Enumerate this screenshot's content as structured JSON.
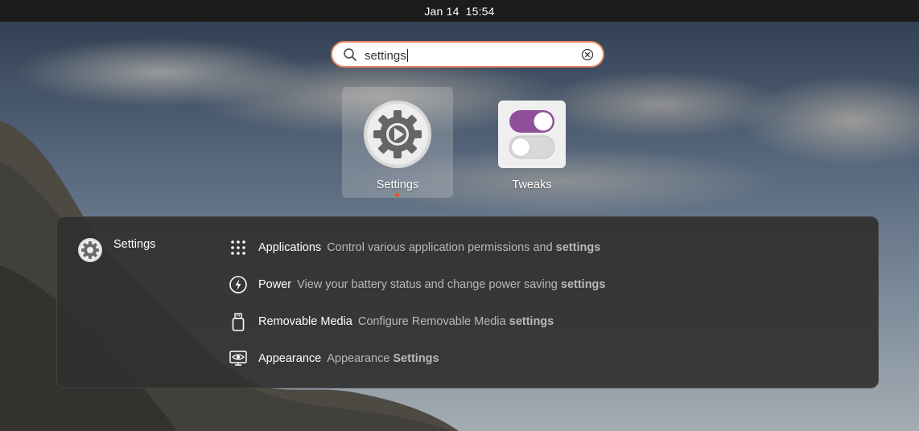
{
  "topbar": {
    "date": "Jan 14",
    "time": "15:54"
  },
  "search": {
    "value": "settings"
  },
  "apps": [
    {
      "label": "Settings",
      "selected": true,
      "running": true
    },
    {
      "label": "Tweaks",
      "selected": false,
      "running": false
    }
  ],
  "results": {
    "provider": "Settings",
    "items": [
      {
        "title": "Applications",
        "description": "Control various application permissions and",
        "match": "settings",
        "icon": "apps-grid-icon"
      },
      {
        "title": "Power",
        "description": "View your battery status and change power saving",
        "match": "settings",
        "icon": "power-icon"
      },
      {
        "title": "Removable Media",
        "description": "Configure Removable Media",
        "match": "settings",
        "icon": "removable-media-icon"
      },
      {
        "title": "Appearance",
        "description": "Appearance",
        "match": "Settings",
        "icon": "appearance-icon"
      }
    ]
  },
  "colors": {
    "accent": "#e95420",
    "search_border": "#e9865f",
    "tweaks_toggle_on": "#8f4f9a"
  }
}
